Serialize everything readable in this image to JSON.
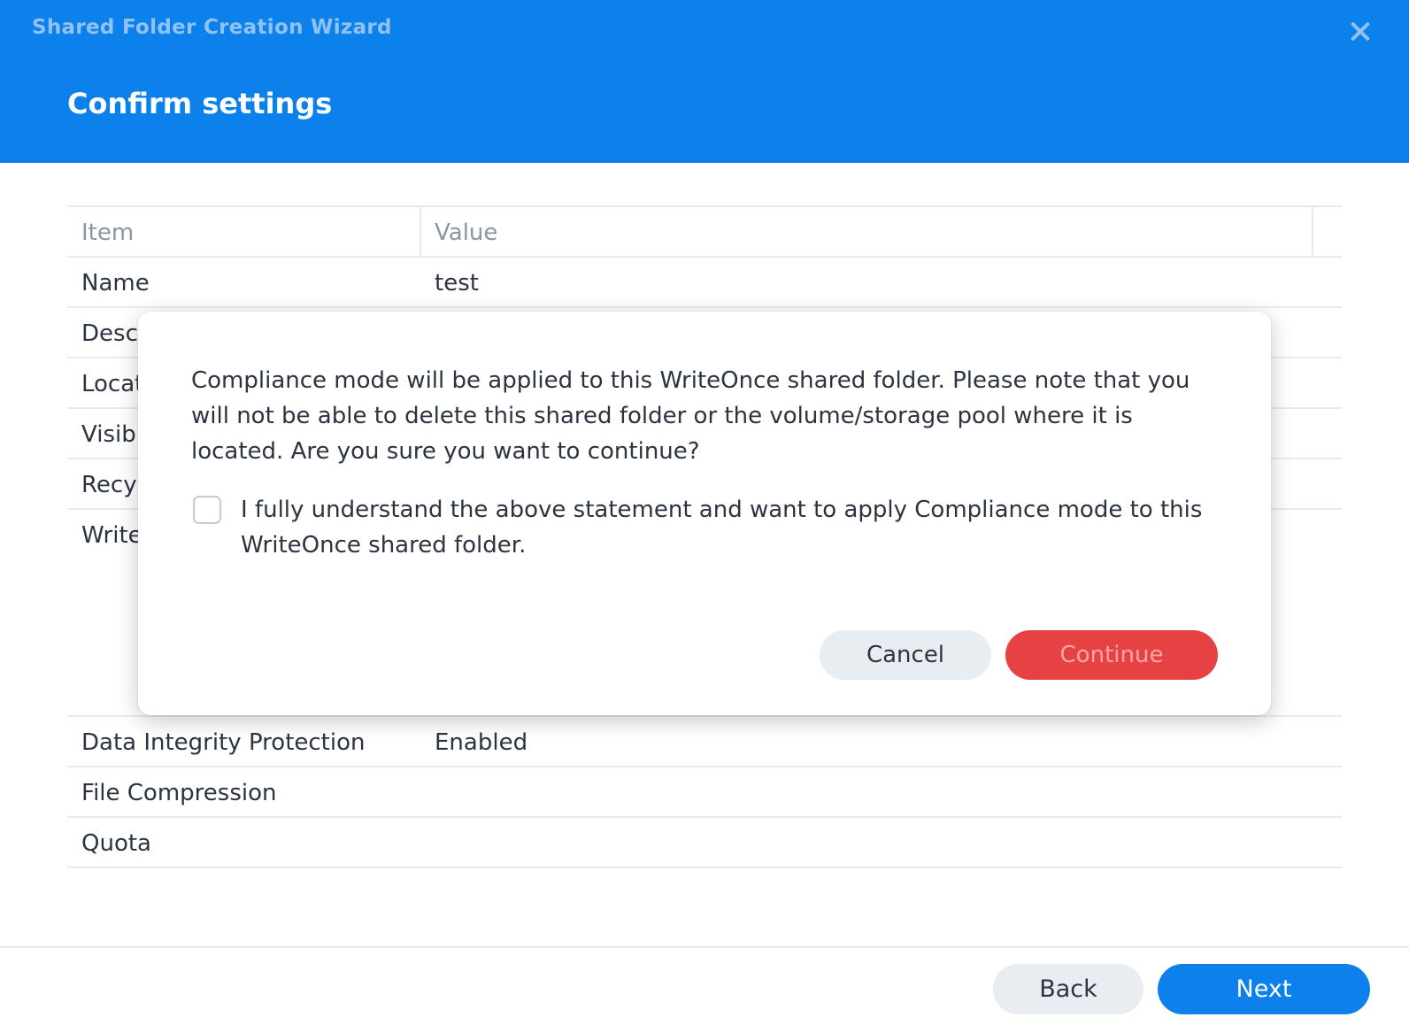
{
  "window": {
    "title": "Shared Folder Creation Wizard",
    "step_title": "Confirm settings"
  },
  "table": {
    "headers": {
      "item": "Item",
      "value": "Value"
    },
    "rows": [
      {
        "item": "Name",
        "value": "test"
      },
      {
        "item": "Desc",
        "value": ""
      },
      {
        "item": "Locat",
        "value": ""
      },
      {
        "item": "Visibl",
        "value": ""
      },
      {
        "item": "Recyc",
        "value": ""
      },
      {
        "item": "Write",
        "value": ""
      },
      {
        "item": "Data Integrity Protection",
        "value": "Enabled"
      },
      {
        "item": "File Compression",
        "value": ""
      },
      {
        "item": "Quota",
        "value": ""
      }
    ]
  },
  "footer": {
    "back_label": "Back",
    "next_label": "Next"
  },
  "dialog": {
    "message": "Compliance mode will be applied to this WriteOnce shared folder. Please note that you will not be able to delete this shared folder or the volume/storage pool where it is located. Are you sure you want to continue?",
    "checkbox_label": "I fully understand the above statement and want to apply Compliance mode to this WriteOnce shared folder.",
    "checkbox_checked": false,
    "cancel_label": "Cancel",
    "continue_label": "Continue"
  },
  "colors": {
    "header_bg": "#0c80eb",
    "primary": "#0c80eb",
    "danger": "#e64243"
  }
}
